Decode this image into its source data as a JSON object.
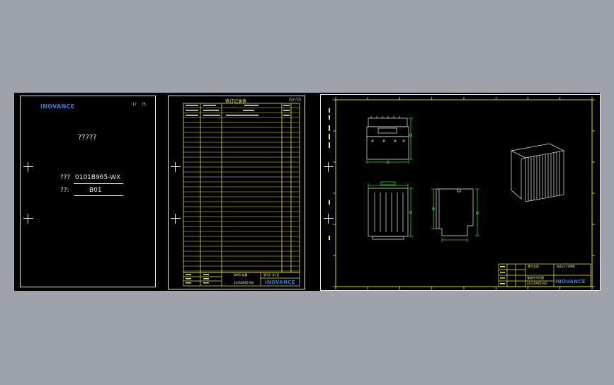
{
  "cover": {
    "logo": "INOVANCE",
    "corner_left": "1?",
    "corner_right": "?5",
    "heading": "?????",
    "part_label": "???",
    "part_value": "0101B965-WX",
    "rev_label": "??:",
    "rev_value": "B01"
  },
  "revision_sheet": {
    "title": "修订记录表",
    "page_mark": "页次 /2页",
    "footer_title": "DWG 标题",
    "footer_code": "0101B965-WX",
    "footer_page": "第1页 共1页",
    "logo": "INOVANCE"
  },
  "drawing_sheet": {
    "logo": "INOVANCE",
    "title_block_name": "零部件外形图",
    "title_block_code": "0101B965-WX",
    "label_a": "零件名称",
    "label_b": "外形尺寸(MM)"
  },
  "colors": {
    "canvas_bg": "#9ea3ab",
    "model_bg": "#000000",
    "sheet_line": "#e8e8e8",
    "yellow": "#e8e84a",
    "green": "#2fd02f",
    "brand_blue": "#2a7fd9"
  }
}
